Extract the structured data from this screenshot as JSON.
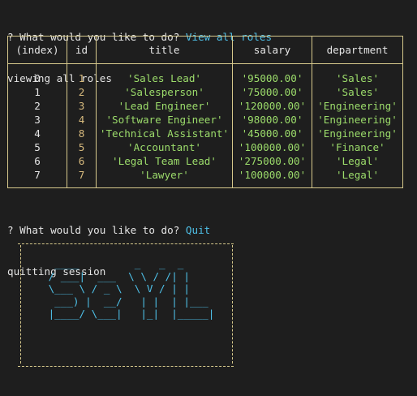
{
  "prompt1": {
    "question": "? What would you like to do?",
    "answer": "View all roles"
  },
  "status1": "viewing all roles",
  "table": {
    "headers": [
      "(index)",
      "id",
      "title",
      "salary",
      "department"
    ],
    "rows": [
      {
        "index": "0",
        "id": "1",
        "title": "'Sales Lead'",
        "salary": "'95000.00'",
        "department": "'Sales'"
      },
      {
        "index": "1",
        "id": "2",
        "title": "'Salesperson'",
        "salary": "'75000.00'",
        "department": "'Sales'"
      },
      {
        "index": "2",
        "id": "3",
        "title": "'Lead Engineer'",
        "salary": "'120000.00'",
        "department": "'Engineering'"
      },
      {
        "index": "3",
        "id": "4",
        "title": "'Software Engineer'",
        "salary": "'98000.00'",
        "department": "'Engineering'"
      },
      {
        "index": "4",
        "id": "8",
        "title": "'Technical Assistant'",
        "salary": "'45000.00'",
        "department": "'Engineering'"
      },
      {
        "index": "5",
        "id": "5",
        "title": "'Accountant'",
        "salary": "'100000.00'",
        "department": "'Finance'"
      },
      {
        "index": "6",
        "id": "6",
        "title": "'Legal Team Lead'",
        "salary": "'275000.00'",
        "department": "'Legal'"
      },
      {
        "index": "7",
        "id": "7",
        "title": "'Lawyer'",
        "salary": "'100000.00'",
        "department": "'Legal'"
      }
    ]
  },
  "prompt2": {
    "question": "? What would you like to do?",
    "answer": "Quit"
  },
  "status2": "quitting session",
  "banner": {
    "ascii": "  ____         _   _  _     \n / ___|  ___  \\ \\ / /| |    \n \\___ \\ / _ \\  \\ V / | |    \n  ___) |  __/   | |  | |___ \n |____/ \\___|   |_|  |_____|"
  },
  "colors": {
    "accent": "#4fc1e9",
    "border": "#d7c98c",
    "string": "#9cdc6b",
    "number": "#d7ba7d",
    "background": "#1e1e1e"
  }
}
